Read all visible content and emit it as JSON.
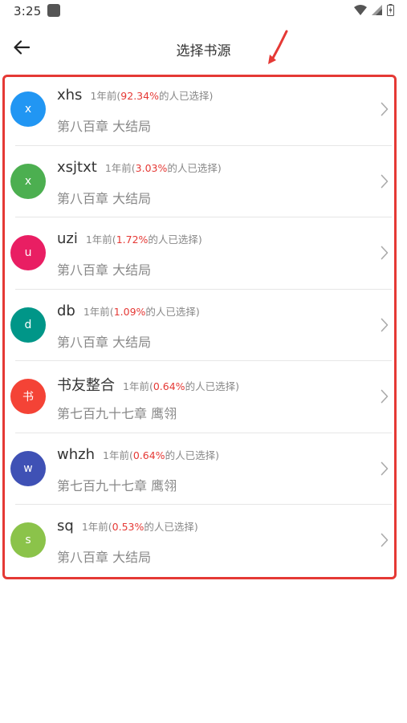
{
  "status_bar": {
    "time": "3:25"
  },
  "header": {
    "title": "选择书源"
  },
  "sources": [
    {
      "avatar": "x",
      "color": "#2196f3",
      "name": "xhs",
      "time": "1年前(",
      "percent": "92.34%",
      "suffix": "的人已选择)",
      "chapter": "第八百章 大结局"
    },
    {
      "avatar": "x",
      "color": "#4caf50",
      "name": "xsjtxt",
      "time": "1年前(",
      "percent": "3.03%",
      "suffix": "的人已选择)",
      "chapter": "第八百章 大结局"
    },
    {
      "avatar": "u",
      "color": "#e91e63",
      "name": "uzi",
      "time": "1年前(",
      "percent": "1.72%",
      "suffix": "的人已选择)",
      "chapter": "第八百章 大结局"
    },
    {
      "avatar": "d",
      "color": "#009688",
      "name": "db",
      "time": "1年前(",
      "percent": "1.09%",
      "suffix": "的人已选择)",
      "chapter": "第八百章 大结局"
    },
    {
      "avatar": "书",
      "color": "#f44336",
      "name": "书友整合",
      "time": "1年前(",
      "percent": "0.64%",
      "suffix": "的人已选择)",
      "chapter": "第七百九十七章 鹰翎"
    },
    {
      "avatar": "w",
      "color": "#3f51b5",
      "name": "whzh",
      "time": "1年前(",
      "percent": "0.64%",
      "suffix": "的人已选择)",
      "chapter": "第七百九十七章 鹰翎"
    },
    {
      "avatar": "s",
      "color": "#8bc34a",
      "name": "sq",
      "time": "1年前(",
      "percent": "0.53%",
      "suffix": "的人已选择)",
      "chapter": "第八百章 大结局"
    }
  ]
}
